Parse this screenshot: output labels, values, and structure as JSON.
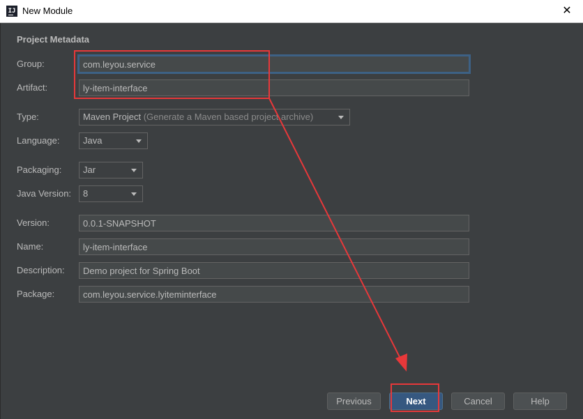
{
  "window": {
    "title": "New Module",
    "close_glyph": "✕",
    "app_icon_text": "IJ"
  },
  "section_title": "Project Metadata",
  "fields": {
    "group": {
      "label": "Group:",
      "value": "com.leyou.service"
    },
    "artifact": {
      "label": "Artifact:",
      "value": "ly-item-interface"
    },
    "version": {
      "label": "Version:",
      "value": "0.0.1-SNAPSHOT"
    },
    "name": {
      "label": "Name:",
      "value": "ly-item-interface"
    },
    "description": {
      "label": "Description:",
      "value": "Demo project for Spring Boot"
    },
    "package": {
      "label": "Package:",
      "value": "com.leyou.service.lyiteminterface"
    }
  },
  "combos": {
    "type": {
      "label": "Type:",
      "value": "Maven Project",
      "hint": "(Generate a Maven based project archive)"
    },
    "language": {
      "label": "Language:",
      "value": "Java"
    },
    "packaging": {
      "label": "Packaging:",
      "value": "Jar"
    },
    "java_version": {
      "label": "Java Version:",
      "value": "8"
    }
  },
  "buttons": {
    "previous": "Previous",
    "next": "Next",
    "cancel": "Cancel",
    "help": "Help"
  },
  "colors": {
    "background": "#3c3f41",
    "field_background": "#45494a",
    "focus_border": "#3d6185",
    "primary_button": "#365880",
    "annotation_red": "#e8383a"
  }
}
